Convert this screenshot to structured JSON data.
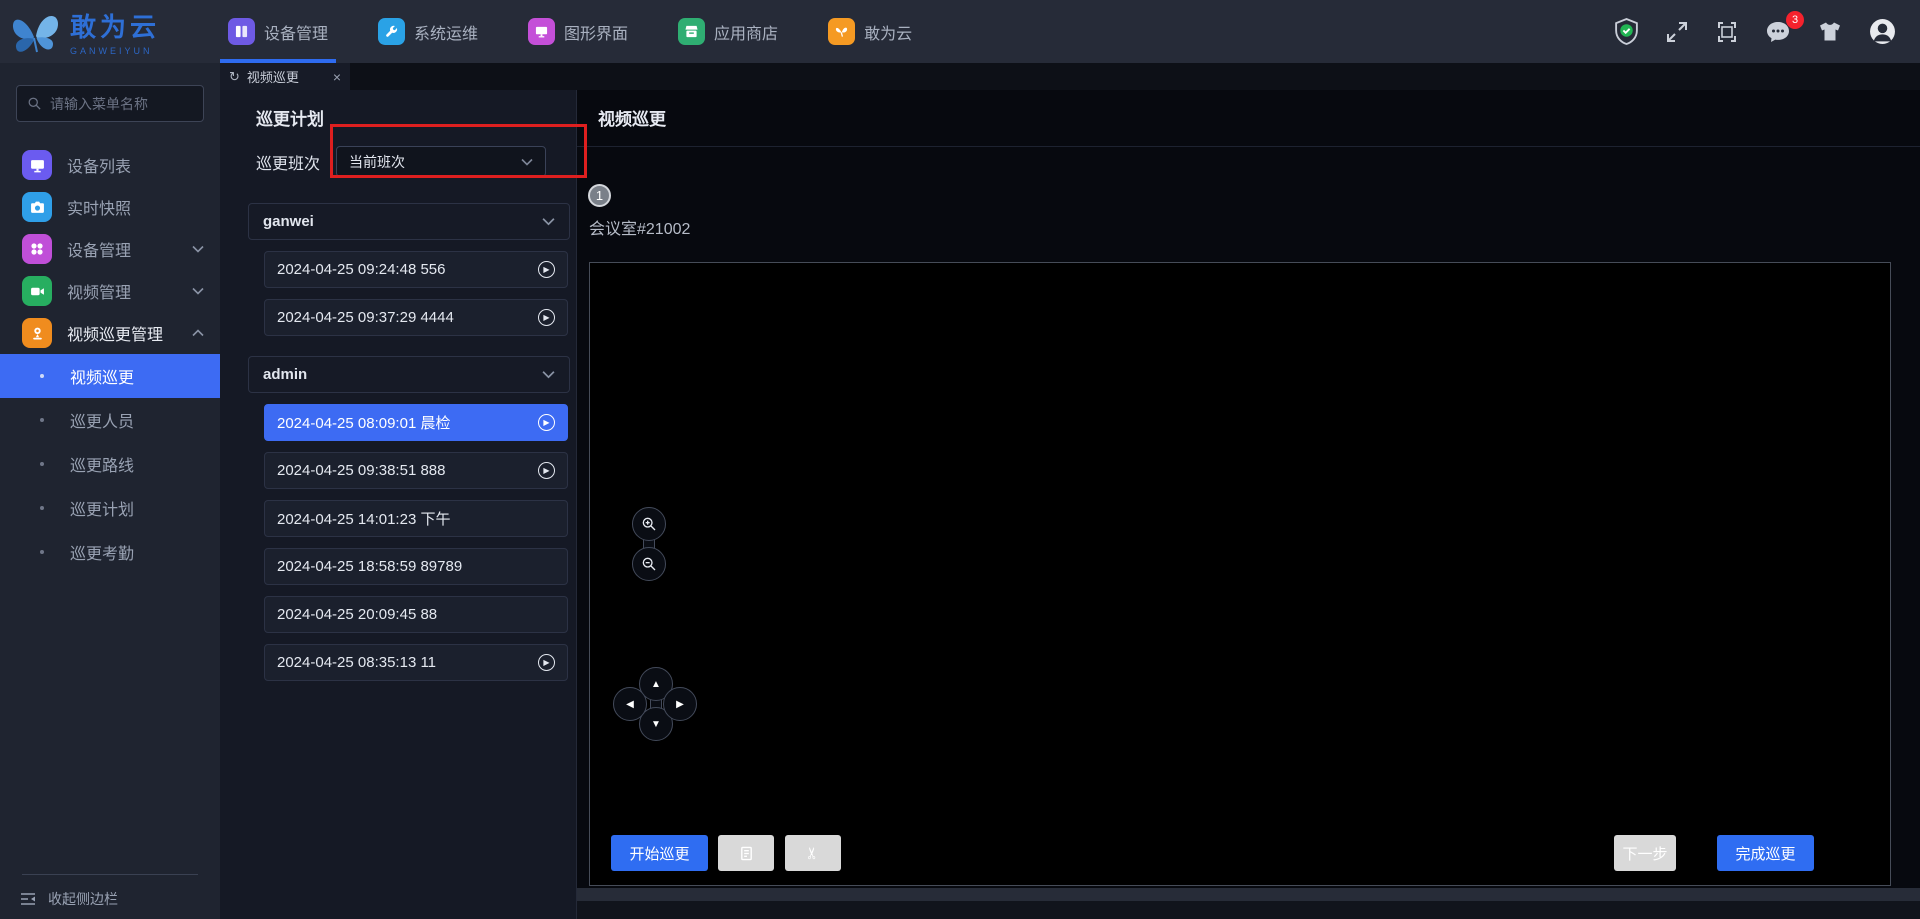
{
  "brand": {
    "name": "敢为云",
    "subtitle": "GANWEIYUN"
  },
  "top_nav": {
    "tabs": [
      {
        "label": "设备管理",
        "icon_color": "#6e5ae4",
        "active": true
      },
      {
        "label": "系统运维",
        "icon_color": "#2aa2e6",
        "active": false
      },
      {
        "label": "图形界面",
        "icon_color": "#c44fd8",
        "active": false
      },
      {
        "label": "应用商店",
        "icon_color": "#2fae72",
        "active": false
      },
      {
        "label": "敢为云",
        "icon_color": "#f59a23",
        "active": false
      }
    ],
    "message_badge": "3"
  },
  "sidebar": {
    "search_placeholder": "请输入菜单名称",
    "items": [
      {
        "label": "设备列表",
        "icon_color": "#6b5bf0"
      },
      {
        "label": "实时快照",
        "icon_color": "#2f9fe8"
      },
      {
        "label": "设备管理",
        "icon_color": "#c04fd8",
        "chevron": "down"
      },
      {
        "label": "视频管理",
        "icon_color": "#27ae60",
        "chevron": "down"
      },
      {
        "label": "视频巡更管理",
        "icon_color": "#f08c1e",
        "chevron": "up",
        "expanded": true
      }
    ],
    "subitems": [
      {
        "label": "视频巡更",
        "active": true
      },
      {
        "label": "巡更人员",
        "active": false
      },
      {
        "label": "巡更路线",
        "active": false
      },
      {
        "label": "巡更计划",
        "active": false
      },
      {
        "label": "巡更考勤",
        "active": false
      }
    ],
    "collapse_label": "收起侧边栏"
  },
  "tabstrip": {
    "active_tab": "视频巡更"
  },
  "plan": {
    "title": "巡更计划",
    "shift_label": "巡更班次",
    "shift_value": "当前班次",
    "groups": [
      {
        "name": "ganwei",
        "items": [
          {
            "time": "2024-04-25 09:24:48 556",
            "play": true,
            "selected": false
          },
          {
            "time": "2024-04-25 09:37:29 4444",
            "play": true,
            "selected": false
          }
        ]
      },
      {
        "name": "admin",
        "items": [
          {
            "time": "2024-04-25 08:09:01 晨检",
            "play": true,
            "selected": true
          },
          {
            "time": "2024-04-25 09:38:51 888",
            "play": true,
            "selected": false
          },
          {
            "time": "2024-04-25 14:01:23 下午",
            "play": false,
            "selected": false
          },
          {
            "time": "2024-04-25 18:58:59 89789",
            "play": false,
            "selected": false
          },
          {
            "time": "2024-04-25 20:09:45 88",
            "play": false,
            "selected": false
          },
          {
            "time": "2024-04-25 08:35:13 11",
            "play": true,
            "selected": false
          }
        ]
      }
    ]
  },
  "main": {
    "title": "视频巡更",
    "step_badge": "1",
    "camera_name": "会议室#21002",
    "buttons": {
      "start": "开始巡更",
      "next": "下一步",
      "finish": "完成巡更"
    }
  },
  "icons": {
    "refresh": "↻",
    "close": "×",
    "play": "▶",
    "arrow_up": "▲",
    "arrow_down": "▼",
    "arrow_left": "◀",
    "arrow_right": "▶",
    "scissors": "✂"
  },
  "colors": {
    "accent_blue": "#2f6df2",
    "selected_blue": "#3d6bf3",
    "annotation_red": "#de1f1f",
    "topnav_bg": "#262b38",
    "sidebar_bg": "#1f2430",
    "panel_bg": "#151925",
    "badge_red": "#f5222d",
    "disabled_gray": "#d9d9d9"
  }
}
